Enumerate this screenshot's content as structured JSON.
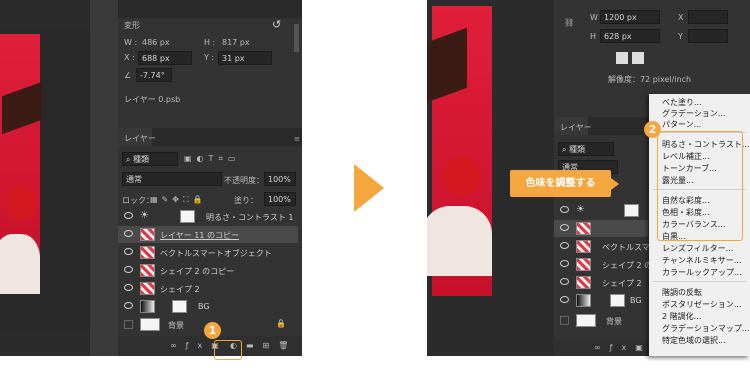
{
  "left": {
    "properties": {
      "section_title": "変形",
      "w_label": "W :",
      "w_value": "486 px",
      "h_label": "H :",
      "h_value": "817 px",
      "x_label": "X :",
      "x_value": "688 px",
      "y_label": "Y :",
      "y_value": "31 px",
      "angle_value": "-7.74°",
      "layer_file": "レイヤー 0.psb"
    },
    "layers_panel": {
      "tab_label": "レイヤー",
      "filter_label": "種類",
      "blend_mode": "通常",
      "opacity_label": "不透明度：",
      "opacity_value": "100%",
      "lock_label": "ロック：",
      "fill_label": "塗り：",
      "fill_value": "100%",
      "layers": [
        {
          "name": "明るさ・コントラスト 1"
        },
        {
          "name": "レイヤー 11 のコピー"
        },
        {
          "name": "ベクトルスマートオブジェクト"
        },
        {
          "name": "シェイプ 2 のコピー"
        },
        {
          "name": "シェイプ 2"
        },
        {
          "name": "BG"
        },
        {
          "name": "背景"
        }
      ]
    },
    "badge": "1"
  },
  "right": {
    "properties": {
      "w_label": "W",
      "w_value": "1200 px",
      "x_label": "X",
      "h_label": "H",
      "h_value": "628 px",
      "y_label": "Y",
      "resolution": "解像度：72 pixel/inch"
    },
    "layers_panel": {
      "tab_label": "レイヤー",
      "filter_label": "種類",
      "blend_mode": "通常",
      "layers": [
        {
          "name": "ベクトルスマ"
        },
        {
          "name": "シェイプ 2 の"
        },
        {
          "name": "シェイプ 2"
        },
        {
          "name": "BG"
        },
        {
          "name": "背景"
        }
      ]
    },
    "badge": "2",
    "callout": "色味を調整する"
  },
  "adjustment_menu": {
    "group1": [
      "べた塗り...",
      "グラデーション...",
      "パターン..."
    ],
    "group2": [
      "明るさ・コントラスト...",
      "レベル補正...",
      "トーンカーブ...",
      "露光量..."
    ],
    "group3": [
      "自然な彩度...",
      "色相・彩度...",
      "カラーバランス...",
      "白黒...",
      "レンズフィルター...",
      "チャンネルミキサー...",
      "カラールックアップ..."
    ],
    "group4": [
      "階調の反転",
      "ポスタリゼーション...",
      "2 階調化...",
      "グラデーションマップ...",
      "特定色域の選択..."
    ]
  },
  "colors": {
    "accent": "#f5a63f",
    "panel": "#333333",
    "canvas": "#2b2b2b"
  }
}
